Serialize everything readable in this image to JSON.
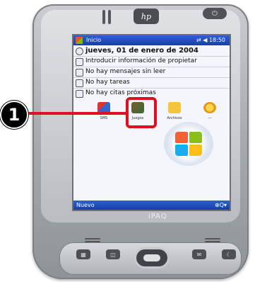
{
  "device": {
    "brand_logo": "hp",
    "model_label": "iPAQ"
  },
  "screen": {
    "titlebar": {
      "title": "Inicio",
      "status": "⇄ ◀ 18:50"
    },
    "today_rows": [
      {
        "icon": "clock-icon",
        "text": "jueves, 01 de enero de 2004"
      },
      {
        "icon": "contact-icon",
        "text": "Introducir información de propietar"
      },
      {
        "icon": "mail-icon",
        "text": "No hay mensajes sin leer"
      },
      {
        "icon": "task-icon",
        "text": "No hay tareas"
      },
      {
        "icon": "calendar-icon",
        "text": "No hay citas próximas"
      }
    ],
    "apps": [
      {
        "name": "net",
        "label": "SMS"
      },
      {
        "name": "games",
        "label": "Juegos"
      },
      {
        "name": "folder",
        "label": "Archivos"
      },
      {
        "name": "settings",
        "label": "—"
      }
    ],
    "softkeys": {
      "left": "Nuevo",
      "right": "⊕Q▾"
    }
  },
  "annotation": {
    "number": "1",
    "color": "#e01020"
  }
}
